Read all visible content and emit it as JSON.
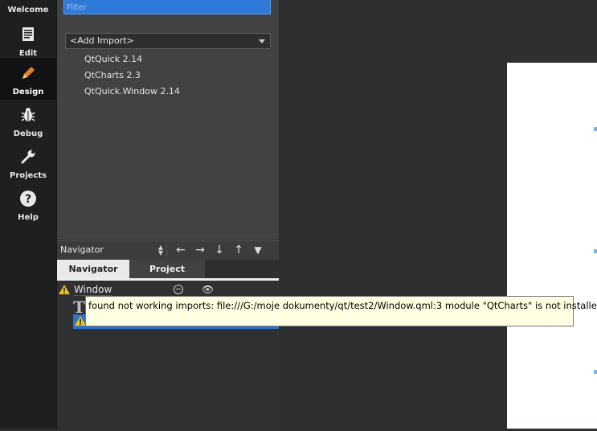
{
  "modes": [
    {
      "label": "Welcome",
      "icon": "welcome-icon"
    },
    {
      "label": "Edit",
      "icon": "document-icon"
    },
    {
      "label": "Design",
      "icon": "pencil-icon"
    },
    {
      "label": "Debug",
      "icon": "bug-icon"
    },
    {
      "label": "Projects",
      "icon": "wrench-icon"
    },
    {
      "label": "Help",
      "icon": "help-icon"
    }
  ],
  "library": {
    "filter_placeholder": "Filter",
    "add_import": "<Add Import>",
    "imports": [
      "QtQuick 2.14",
      "QtCharts 2.3",
      "QtQuick.Window 2.14"
    ]
  },
  "navigator": {
    "combo_value": "Navigator",
    "tabs": [
      "Navigator",
      "Project"
    ],
    "root_item": "Window"
  },
  "tooltip": "found not working imports: file:///G:/moje dokumenty/qt/test2/Window.qml:3 module \"QtCharts\" is not installed",
  "colors": {
    "accent": "#2f73c8",
    "warning": "#f0c419",
    "sidebar": "#1e1f21",
    "panel": "#404244"
  }
}
